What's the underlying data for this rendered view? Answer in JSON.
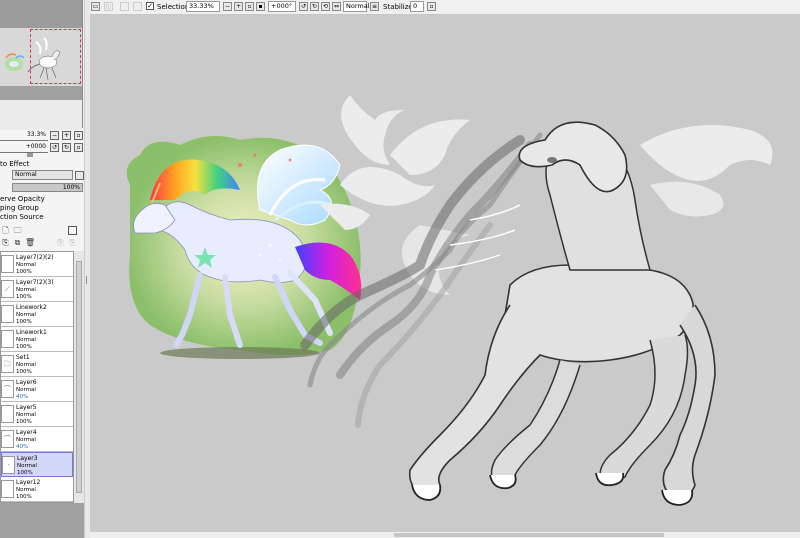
{
  "navigator": {
    "zoom": "33.3%",
    "rotation": "+0000"
  },
  "layer_props": {
    "clip_to_effect": "to Effect",
    "blend_mode": "Normal",
    "opacity": "100%",
    "opacity_fraction": 1.0,
    "preserve_opacity": "erve Opacity",
    "clipping_group": "ping Group",
    "selection_source": "ction Source"
  },
  "layers": [
    {
      "name": "Layer7(2)(2)",
      "mode": "Normal",
      "opacity": "100%",
      "selected": false
    },
    {
      "name": "Layer7(2)(3)",
      "mode": "Normal",
      "opacity": "100%",
      "selected": false
    },
    {
      "name": "Linework2",
      "mode": "Normal",
      "opacity": "100%",
      "selected": false
    },
    {
      "name": "Linework1",
      "mode": "Normal",
      "opacity": "100%",
      "selected": false
    },
    {
      "name": "Set1",
      "mode": "Normal",
      "opacity": "100%",
      "selected": false
    },
    {
      "name": "Layer6",
      "mode": "Normal",
      "opacity": "40%",
      "selected": false
    },
    {
      "name": "Layer5",
      "mode": "Normal",
      "opacity": "100%",
      "selected": false
    },
    {
      "name": "Layer4",
      "mode": "Normal",
      "opacity": "40%",
      "selected": false
    },
    {
      "name": "Layer3",
      "mode": "Normal",
      "opacity": "100%",
      "selected": true
    },
    {
      "name": "Layer12",
      "mode": "Normal",
      "opacity": "100%",
      "selected": false
    }
  ],
  "toolbar": {
    "selection_label": "Selection",
    "zoom_value": "33.33%",
    "rotation_value": "+000°",
    "blend_value": "Normal",
    "stabilizer_label": "Stabilizer",
    "stabilizer_value": "0"
  },
  "colors": {
    "selected_layer_bg": "#d4d8f8",
    "navigator_frame": "#e0324e",
    "canvas_bg": "#cacaca"
  }
}
